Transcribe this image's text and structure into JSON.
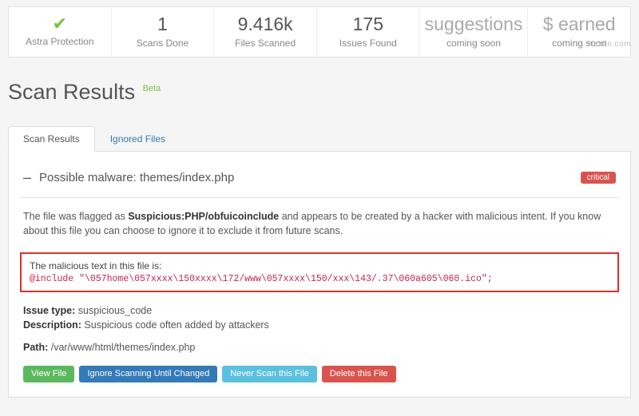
{
  "watermark": "wsxdn.com",
  "stats": [
    {
      "icon": "check",
      "label": "Astra Protection"
    },
    {
      "value": "1",
      "label": "Scans Done"
    },
    {
      "value": "9.416k",
      "label": "Files Scanned"
    },
    {
      "value": "175",
      "label": "Issues Found"
    },
    {
      "value": "suggestions",
      "label": "coming soon",
      "muted": true
    },
    {
      "value": "$ earned",
      "label": "coming soon",
      "muted": true
    }
  ],
  "page_title": "Scan Results",
  "badge_beta": "Beta",
  "tabs": {
    "scan_results": "Scan Results",
    "ignored_files": "Ignored Files"
  },
  "issue": {
    "title": "Possible malware: themes/index.php",
    "severity": "critical",
    "desc_pre": "The file was flagged as ",
    "desc_strong": "Suspicious:PHP/obfuicoinclude",
    "desc_post": " and appears to be created by a hacker with malicious intent. If you know about this file you can choose to ignore it to exclude it from future scans.",
    "malicious_label": "The malicious text in this file is:",
    "malicious_code": "@include \"\\057home\\057xxxx\\150xxxx\\172/www\\057xxxx\\150/xxx\\143/.37\\060a605\\060.ico\";",
    "issue_type_label": "Issue type:",
    "issue_type_value": " suspicious_code",
    "description_label": "Description:",
    "description_value": " Suspicious code often added by attackers",
    "path_label": "Path:",
    "path_value": " /var/www/html/themes/index.php"
  },
  "buttons": {
    "view_file": "View File",
    "ignore_changed": "Ignore Scanning Until Changed",
    "never_scan": "Never Scan this File",
    "delete_file": "Delete this File"
  }
}
